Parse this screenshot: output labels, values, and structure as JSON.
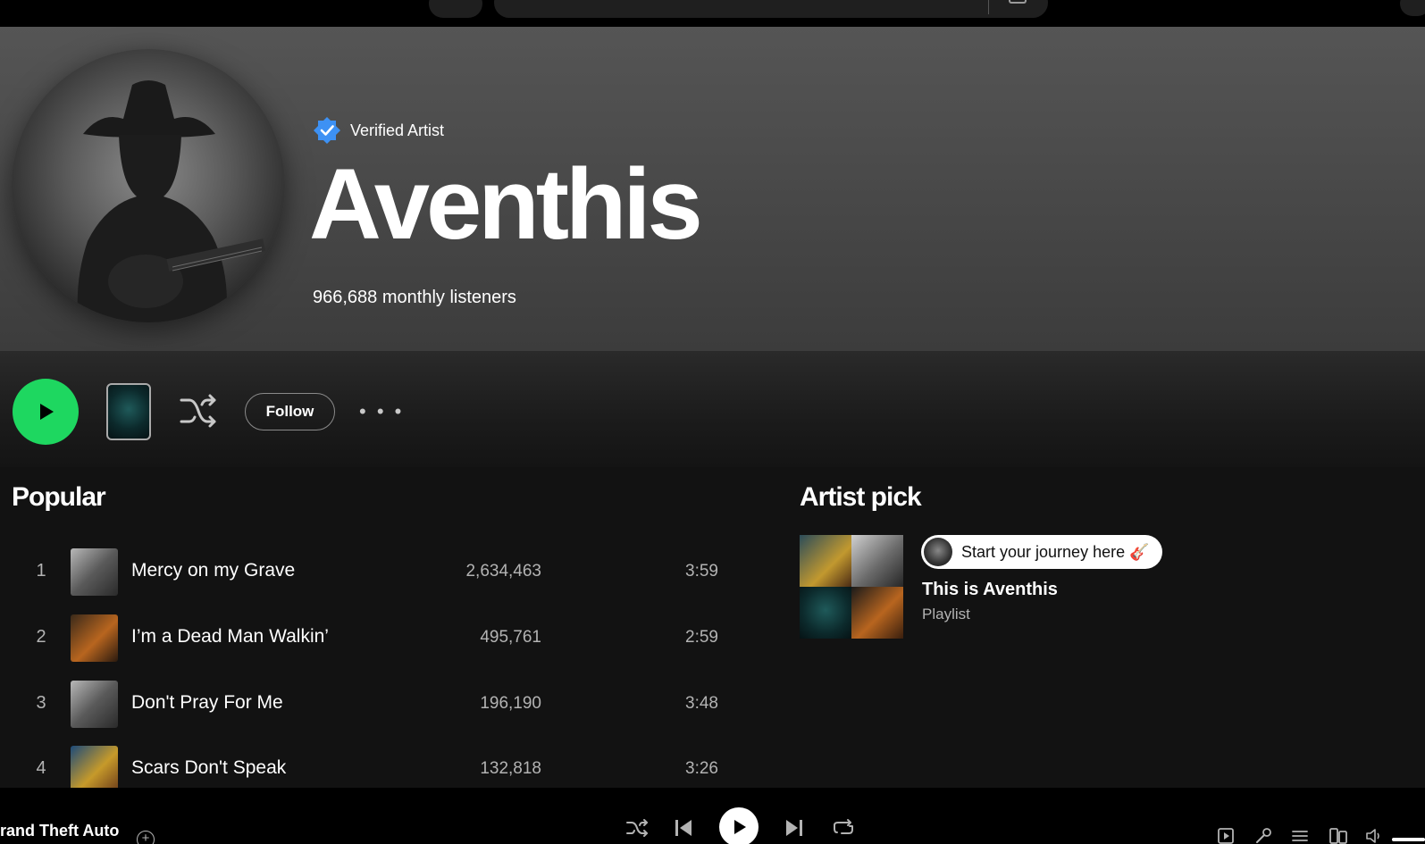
{
  "header": {
    "verified_label": "Verified Artist",
    "artist_name": "Aventhis",
    "monthly_listeners": "966,688 monthly listeners"
  },
  "actions": {
    "follow_label": "Follow",
    "more_label": "• • •"
  },
  "popular": {
    "title": "Popular",
    "tracks": [
      {
        "num": "1",
        "title": "Mercy on my Grave",
        "plays": "2,634,463",
        "duration": "3:59"
      },
      {
        "num": "2",
        "title": "I’m a Dead Man Walkin’",
        "plays": "495,761",
        "duration": "2:59"
      },
      {
        "num": "3",
        "title": "Don't Pray For Me",
        "plays": "196,190",
        "duration": "3:48"
      },
      {
        "num": "4",
        "title": "Scars Don't Speak",
        "plays": "132,818",
        "duration": "3:26"
      }
    ]
  },
  "artist_pick": {
    "title": "Artist pick",
    "pill_text": "Start your journey here 🎸",
    "name": "This is Aventhis",
    "type": "Playlist"
  },
  "player": {
    "now_playing_title": "rand Theft Auto",
    "add_label": "+"
  },
  "colors": {
    "accent_green": "#1ed760",
    "verified_blue": "#3d91f4",
    "background": "#121212"
  }
}
